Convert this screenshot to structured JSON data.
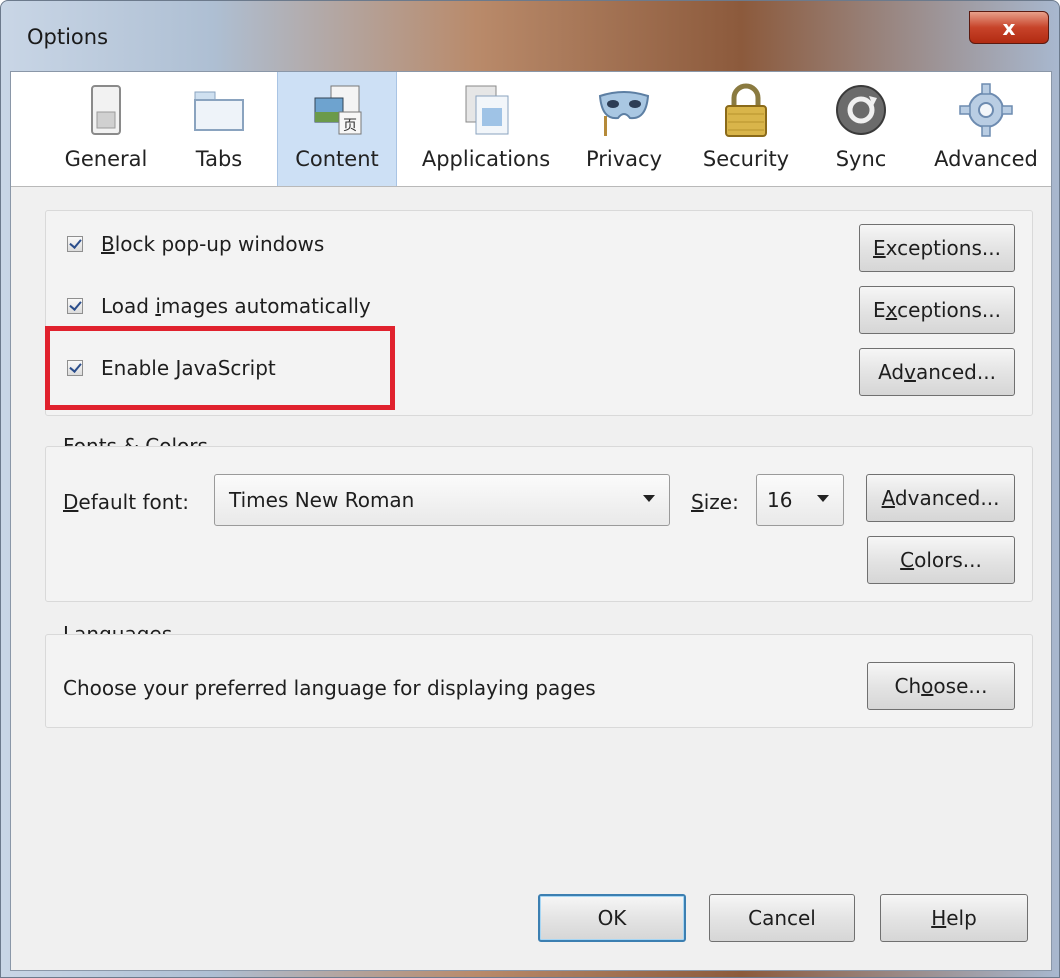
{
  "window": {
    "title": "Options",
    "close_glyph": "x"
  },
  "toolbar": {
    "tabs": [
      {
        "label": "General",
        "icon": "switch-icon"
      },
      {
        "label": "Tabs",
        "icon": "tabs-icon"
      },
      {
        "label": "Content",
        "icon": "content-icon",
        "selected": true
      },
      {
        "label": "Applications",
        "icon": "applications-icon"
      },
      {
        "label": "Privacy",
        "icon": "mask-icon"
      },
      {
        "label": "Security",
        "icon": "padlock-icon"
      },
      {
        "label": "Sync",
        "icon": "sync-icon"
      },
      {
        "label": "Advanced",
        "icon": "gear-icon"
      }
    ]
  },
  "content": {
    "block_popups": {
      "label_pre": "",
      "label_key": "B",
      "label_post": "lock pop-up windows",
      "checked": true,
      "button_pre": "",
      "button_key": "E",
      "button_post": "xceptions..."
    },
    "load_images": {
      "label_pre": "Load ",
      "label_key": "i",
      "label_post": "mages automatically",
      "checked": true,
      "button_pre": "E",
      "button_key": "x",
      "button_post": "ceptions..."
    },
    "javascript": {
      "label_pre": "Enable ",
      "label_key": "J",
      "label_post": "avaScript",
      "checked": true,
      "button_pre": "Ad",
      "button_key": "v",
      "button_post": "anced..."
    }
  },
  "fonts": {
    "title": "Fonts & Colors",
    "default_font_pre": "",
    "default_font_key": "D",
    "default_font_post": "efault font:",
    "font_value": "Times New Roman",
    "size_pre": "",
    "size_key": "S",
    "size_post": "ize:",
    "size_value": "16",
    "advanced_pre": "",
    "advanced_key": "A",
    "advanced_post": "dvanced...",
    "colors_pre": "",
    "colors_key": "C",
    "colors_post": "olors..."
  },
  "languages": {
    "title": "Languages",
    "description": "Choose your preferred language for displaying pages",
    "choose_pre": "Ch",
    "choose_key": "o",
    "choose_post": "ose..."
  },
  "footer": {
    "ok": "OK",
    "cancel": "Cancel",
    "help_pre": "",
    "help_key": "H",
    "help_post": "elp"
  },
  "colors": {
    "highlight": "#e0212d",
    "selected_tab": "#cde0f5"
  }
}
